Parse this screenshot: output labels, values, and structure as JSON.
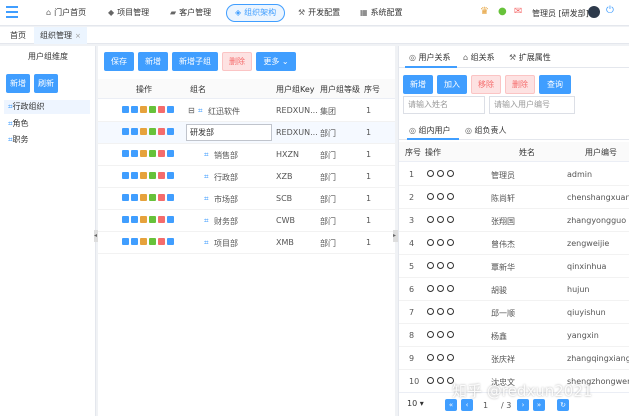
{
  "topnav": {
    "items": [
      {
        "label": "门户首页",
        "icon": "home-icon"
      },
      {
        "label": "项目管理",
        "icon": "cube-icon"
      },
      {
        "label": "客户管理",
        "icon": "car-icon"
      },
      {
        "label": "组织架构",
        "icon": "org-icon",
        "active": true
      },
      {
        "label": "开发配置",
        "icon": "wrench-icon"
      },
      {
        "label": "系统配置",
        "icon": "grid-icon"
      }
    ],
    "user_name": "管理员 [研发部]"
  },
  "tabs": [
    {
      "label": "首页"
    },
    {
      "label": "组织管理",
      "active": true,
      "close": "×"
    }
  ],
  "left_panel": {
    "title": "用户组维度",
    "new_button": "新增",
    "refresh_button": "刷新",
    "items": [
      "行政组织",
      "角色",
      "职务"
    ]
  },
  "mid_panel": {
    "toolbar": {
      "save": "保存",
      "add": "新增",
      "add_child": "新增子组",
      "delete": "删除",
      "more": "更多 ⌄"
    },
    "headers": {
      "ops": "操作",
      "name": "组名",
      "key": "用户组Key",
      "type": "用户组等级",
      "order": "序号"
    },
    "rows": [
      {
        "name": "红迅软件",
        "key": "REDXUN...",
        "type": "集团",
        "order": "1",
        "tree": "⊟"
      },
      {
        "name": "研发部",
        "key": "REDXUN...",
        "type": "部门",
        "order": "1",
        "editing": true
      },
      {
        "name": "销售部",
        "key": "HXZN",
        "type": "部门",
        "order": "1"
      },
      {
        "name": "行政部",
        "key": "XZB",
        "type": "部门",
        "order": "1"
      },
      {
        "name": "市场部",
        "key": "SCB",
        "type": "部门",
        "order": "1"
      },
      {
        "name": "财务部",
        "key": "CWB",
        "type": "部门",
        "order": "1"
      },
      {
        "name": "项目部",
        "key": "XMB",
        "type": "部门",
        "order": "1"
      }
    ]
  },
  "right_panel": {
    "tabs": [
      "用户关系",
      "组关系",
      "扩展属性"
    ],
    "buttons": {
      "new": "新增",
      "join": "加入",
      "remove": "移除",
      "delete": "删除",
      "query": "查询"
    },
    "name_placeholder": "请输入姓名",
    "code_placeholder": "请输入用户编号",
    "subtabs": [
      "组内用户",
      "组负责人"
    ],
    "headers": {
      "order": "序号",
      "ops": "操作",
      "name": "姓名",
      "code": "用户编号"
    },
    "rows": [
      {
        "n": "1",
        "name": "管理员",
        "code": "admin"
      },
      {
        "n": "2",
        "name": "陈尚轩",
        "code": "chenshangxuan"
      },
      {
        "n": "3",
        "name": "张翔国",
        "code": "zhangyongguo"
      },
      {
        "n": "4",
        "name": "曾伟杰",
        "code": "zengweijie"
      },
      {
        "n": "5",
        "name": "覃新华",
        "code": "qinxinhua"
      },
      {
        "n": "6",
        "name": "胡骏",
        "code": "hujun"
      },
      {
        "n": "7",
        "name": "邱一顺",
        "code": "qiuyishun"
      },
      {
        "n": "8",
        "name": "杨鑫",
        "code": "yangxin"
      },
      {
        "n": "9",
        "name": "张庆祥",
        "code": "zhangqingxiang"
      },
      {
        "n": "10",
        "name": "沈忠文",
        "code": "shengzhongwen"
      }
    ],
    "pager": {
      "size": "10",
      "page": "1",
      "total": "/ 3"
    }
  },
  "watermark": "知乎 @redxun2021",
  "colors": {
    "primary": "#409eff",
    "danger": "#f56c6c"
  }
}
